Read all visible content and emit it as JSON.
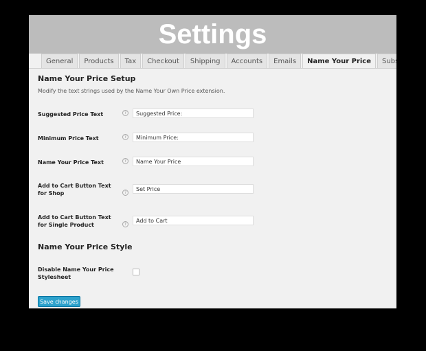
{
  "banner": {
    "title": "Settings"
  },
  "tabs": [
    {
      "label": "General",
      "active": false
    },
    {
      "label": "Products",
      "active": false
    },
    {
      "label": "Tax",
      "active": false
    },
    {
      "label": "Checkout",
      "active": false
    },
    {
      "label": "Shipping",
      "active": false
    },
    {
      "label": "Accounts",
      "active": false
    },
    {
      "label": "Emails",
      "active": false
    },
    {
      "label": "Name Your Price",
      "active": true
    },
    {
      "label": "Subscriptions",
      "active": false
    }
  ],
  "setup": {
    "title": "Name Your Price Setup",
    "description": "Modify the text strings used by the Name Your Own Price extension.",
    "fields": [
      {
        "label": "Suggested Price Text",
        "value": "Suggested Price:"
      },
      {
        "label": "Minimum Price Text",
        "value": "Minimum Price:"
      },
      {
        "label": "Name Your Price Text",
        "value": "Name Your Price"
      },
      {
        "label": "Add to Cart Button Text for Shop",
        "value": "Set Price"
      },
      {
        "label": "Add to Cart Button Text for Single Product",
        "value": "Add to Cart"
      }
    ]
  },
  "style": {
    "title": "Name Your Price Style",
    "stylesheet_label": "Disable Name Your Price Stylesheet",
    "stylesheet_checked": false
  },
  "help_icon": {
    "glyph": "?",
    "icon": "question-circle-icon"
  },
  "save_label": "Save changes",
  "colors": {
    "accent": "#2ea2cc",
    "banner": "#bcbcbc"
  }
}
